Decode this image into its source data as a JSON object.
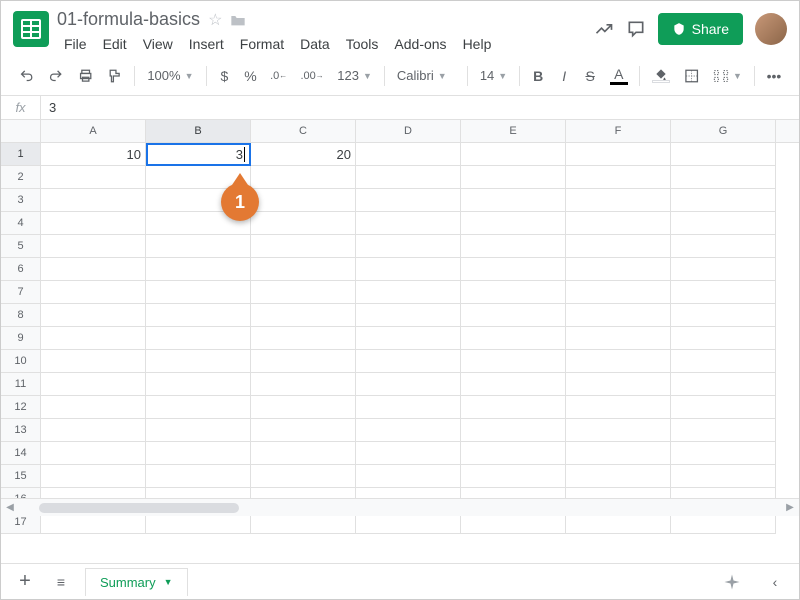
{
  "doc_title": "01-formula-basics",
  "menus": [
    "File",
    "Edit",
    "View",
    "Insert",
    "Format",
    "Data",
    "Tools",
    "Add-ons",
    "Help"
  ],
  "share_label": "Share",
  "zoom": "100%",
  "font_name": "Calibri",
  "font_size": "14",
  "number_format": "123",
  "fx_label": "fx",
  "formula_value": "3",
  "columns": [
    "A",
    "B",
    "C",
    "D",
    "E",
    "F",
    "G"
  ],
  "row_count": 17,
  "active_col_index": 1,
  "active_row": 1,
  "cells": {
    "r1": {
      "A": "10",
      "B": "3",
      "C": "20"
    }
  },
  "callout_num": "1",
  "sheet_tab": "Summary",
  "toolbar_labels": {
    "dollar": "$",
    "percent": "%",
    "dec_dec": ".0",
    "inc_dec": ".00"
  }
}
